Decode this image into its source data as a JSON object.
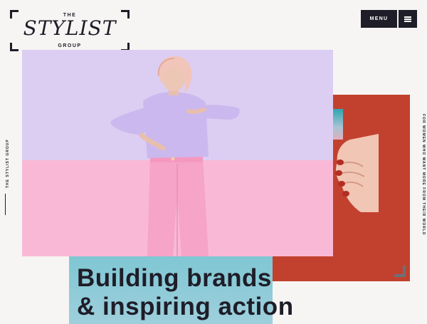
{
  "logo": {
    "the": "THE",
    "main": "STYLIST",
    "group": "GROUP"
  },
  "header": {
    "menu_label": "MENU",
    "menu_icon": "hamburger-icon"
  },
  "side": {
    "left_text": "THE STYLIST GROUP",
    "right_text": "FOR WOMEN WHO WANT MORE FROM THEIR WORLD"
  },
  "hero": {
    "headline_line1": "Building brands",
    "headline_line2": "& inspiring action"
  },
  "colors": {
    "ink": "#1e1d28",
    "lavender": "#dccdf2",
    "pink": "#f9b9d6",
    "red": "#c2412e",
    "teal": "#7fc7d3"
  }
}
